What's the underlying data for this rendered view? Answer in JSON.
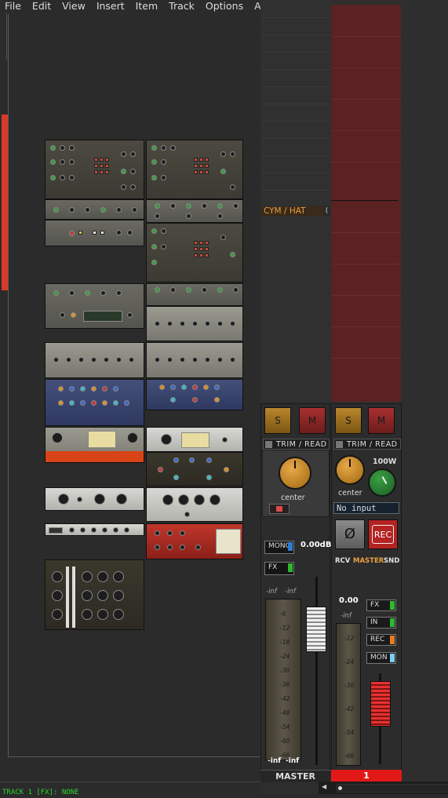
{
  "menu": [
    "File",
    "Edit",
    "View",
    "Insert",
    "Item",
    "Track",
    "Options",
    "Actions"
  ],
  "status": "TRACK 1 [FX]: NONE",
  "track_label": "CYM / HAT",
  "track_label_btn": "(",
  "master": {
    "solo": "S",
    "mute": "M",
    "trim": "TRIM / READ",
    "pan": "center",
    "mono": "MONO",
    "fx": "FX",
    "volume": "0.00dB",
    "meter_left": "-inf",
    "meter_right": "-inf",
    "meter_bottom_left": "-inf",
    "meter_bottom_right": "-inf",
    "ticks": [
      "-6",
      "-12",
      "-18",
      "-24",
      "-30",
      "-36",
      "-42",
      "-48",
      "-54",
      "-60",
      "-66"
    ],
    "name": "MASTER"
  },
  "track1": {
    "solo": "S",
    "mute": "M",
    "trim": "TRIM / READ",
    "pan": "center",
    "width": "100W",
    "input": "No input",
    "phase": "Ø",
    "rec": "REC",
    "rcv": "RCV",
    "route_master": "MASTER",
    "snd": "SND",
    "volume": "0.00",
    "meter": "-inf",
    "ticks": [
      "-12",
      "-24",
      "-30",
      "-42",
      "-54",
      "-66"
    ],
    "fx": "FX",
    "in": "IN",
    "rec_btn": "REC",
    "mon": "MON",
    "name": "1"
  },
  "colors": {
    "accent_orange": "#e8a040",
    "track_red": "#e21818",
    "status_green": "#2bd52b"
  }
}
